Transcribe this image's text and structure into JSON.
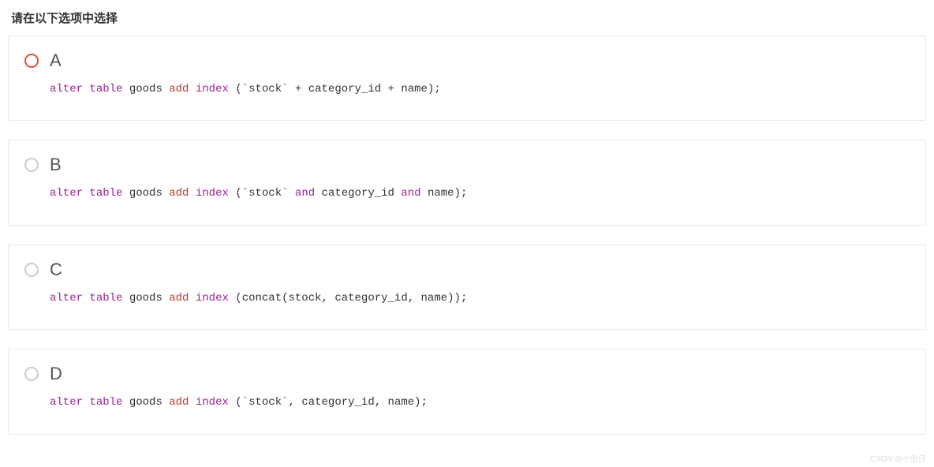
{
  "question": {
    "title": "请在以下选项中选择"
  },
  "options": [
    {
      "letter": "A",
      "selected": true,
      "code_tokens": [
        {
          "t": "alter",
          "c": "kw-alter"
        },
        {
          "t": " ",
          "c": ""
        },
        {
          "t": "table",
          "c": "kw-table"
        },
        {
          "t": " goods ",
          "c": "identifier"
        },
        {
          "t": "add",
          "c": "kw-add"
        },
        {
          "t": " ",
          "c": ""
        },
        {
          "t": "index",
          "c": "kw-index"
        },
        {
          "t": " (",
          "c": "punct"
        },
        {
          "t": "`stock`",
          "c": "string-lit"
        },
        {
          "t": " + category_id + name);",
          "c": "identifier"
        }
      ]
    },
    {
      "letter": "B",
      "selected": false,
      "code_tokens": [
        {
          "t": "alter",
          "c": "kw-alter"
        },
        {
          "t": " ",
          "c": ""
        },
        {
          "t": "table",
          "c": "kw-table"
        },
        {
          "t": " goods ",
          "c": "identifier"
        },
        {
          "t": "add",
          "c": "kw-add"
        },
        {
          "t": " ",
          "c": ""
        },
        {
          "t": "index",
          "c": "kw-index"
        },
        {
          "t": " (",
          "c": "punct"
        },
        {
          "t": "`stock`",
          "c": "string-lit"
        },
        {
          "t": " ",
          "c": ""
        },
        {
          "t": "and",
          "c": "kw-and"
        },
        {
          "t": " category_id ",
          "c": "identifier"
        },
        {
          "t": "and",
          "c": "kw-and"
        },
        {
          "t": " name);",
          "c": "identifier"
        }
      ]
    },
    {
      "letter": "C",
      "selected": false,
      "code_tokens": [
        {
          "t": "alter",
          "c": "kw-alter"
        },
        {
          "t": " ",
          "c": ""
        },
        {
          "t": "table",
          "c": "kw-table"
        },
        {
          "t": " goods ",
          "c": "identifier"
        },
        {
          "t": "add",
          "c": "kw-add"
        },
        {
          "t": " ",
          "c": ""
        },
        {
          "t": "index",
          "c": "kw-index"
        },
        {
          "t": " (concat(stock, category_id, name));",
          "c": "identifier"
        }
      ]
    },
    {
      "letter": "D",
      "selected": false,
      "code_tokens": [
        {
          "t": "alter",
          "c": "kw-alter"
        },
        {
          "t": " ",
          "c": ""
        },
        {
          "t": "table",
          "c": "kw-table"
        },
        {
          "t": " goods ",
          "c": "identifier"
        },
        {
          "t": "add",
          "c": "kw-add"
        },
        {
          "t": " ",
          "c": ""
        },
        {
          "t": "index",
          "c": "kw-index"
        },
        {
          "t": " (",
          "c": "punct"
        },
        {
          "t": "`stock`",
          "c": "string-lit"
        },
        {
          "t": ", category_id, name);",
          "c": "identifier"
        }
      ]
    }
  ],
  "watermark": "CSDN @小虫仔"
}
